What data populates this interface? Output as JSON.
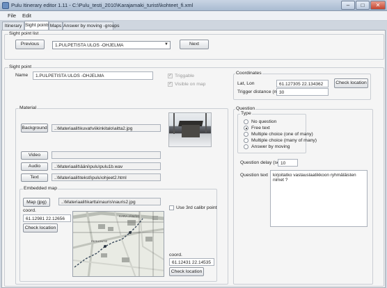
{
  "window": {
    "title": "Pulu Itinerary editor 1.11 - C:\\Pulu_testi_2010\\Karajamaki_turisti\\kohteet_fi.xml",
    "minimize": "–",
    "maximize": "□",
    "close": "✕"
  },
  "menu": {
    "file": "File",
    "edit": "Edit"
  },
  "tabs": [
    {
      "label": "Itinerary"
    },
    {
      "label": "Sight points"
    },
    {
      "label": "Maps"
    },
    {
      "label": "Answer by moving -groups"
    }
  ],
  "sight_point_list": {
    "group_label": "Sight point list",
    "previous_label": "Previous",
    "selected": "1.PULPETISTA ULOS -OHJELMA",
    "next_label": "Next"
  },
  "sight_point": {
    "group_label": "Sight point",
    "name_label": "Name",
    "name_value": "1.PULPETISTA ULOS -OHJELMA",
    "triggable_label": "Triggable",
    "visible_on_map_label": "Visible on map"
  },
  "coordinates": {
    "group_label": "Coordinates",
    "latlon_label": "Lat, Lon",
    "latlon_value": "61.127305 22.134362",
    "trigger_label": "Trigger distance (m)",
    "trigger_value": "30",
    "check_label": "Check location"
  },
  "material": {
    "group_label": "Material",
    "background_label": "Background",
    "background_path": "..\\Materiaalit\\kuvat\\viikinkitalo\\aitta2.jpg",
    "video_label": "Video",
    "video_path": "",
    "audio_label": "Audio",
    "audio_path": "..\\Materiaalit\\ääni\\pulu\\pulu1b.wav",
    "text_label": "Text",
    "text_path": "..\\Materiaalit\\teksti\\pulu\\ohjeet2.html"
  },
  "embedded_map": {
    "group_label": "Embedded map",
    "map_button_label": "Map (jpg)",
    "map_path": "..\\Materiaalit\\kartta\\nauris\\nauris2.jpg",
    "use_3rd_label": "Use 3rd calibr point",
    "coord_label_1": "coord.",
    "coord_value_1": "61.12981 22.12656",
    "check_label_1": "Check location",
    "coord_label_2": "coord.",
    "coord_value_2": "61.12431 22.14535",
    "check_label_2": "Check location",
    "map_labels": [
      "KARA JÄMÄKI",
      "PERHONTIE"
    ]
  },
  "question": {
    "group_label": "Question",
    "type_label": "Type",
    "options": [
      {
        "label": "No question",
        "selected": false
      },
      {
        "label": "Free text",
        "selected": true
      },
      {
        "label": "Multiple choice (one of many)",
        "selected": false
      },
      {
        "label": "Multiple choice (many of many)",
        "selected": false
      },
      {
        "label": "Answer by moving",
        "selected": false
      }
    ],
    "delay_label": "Question delay (sec)",
    "delay_value": "10",
    "text_label": "Question text",
    "text_value": "kirjoitatko vastauslaatikkoon ryhmäläisten nimet ?"
  }
}
